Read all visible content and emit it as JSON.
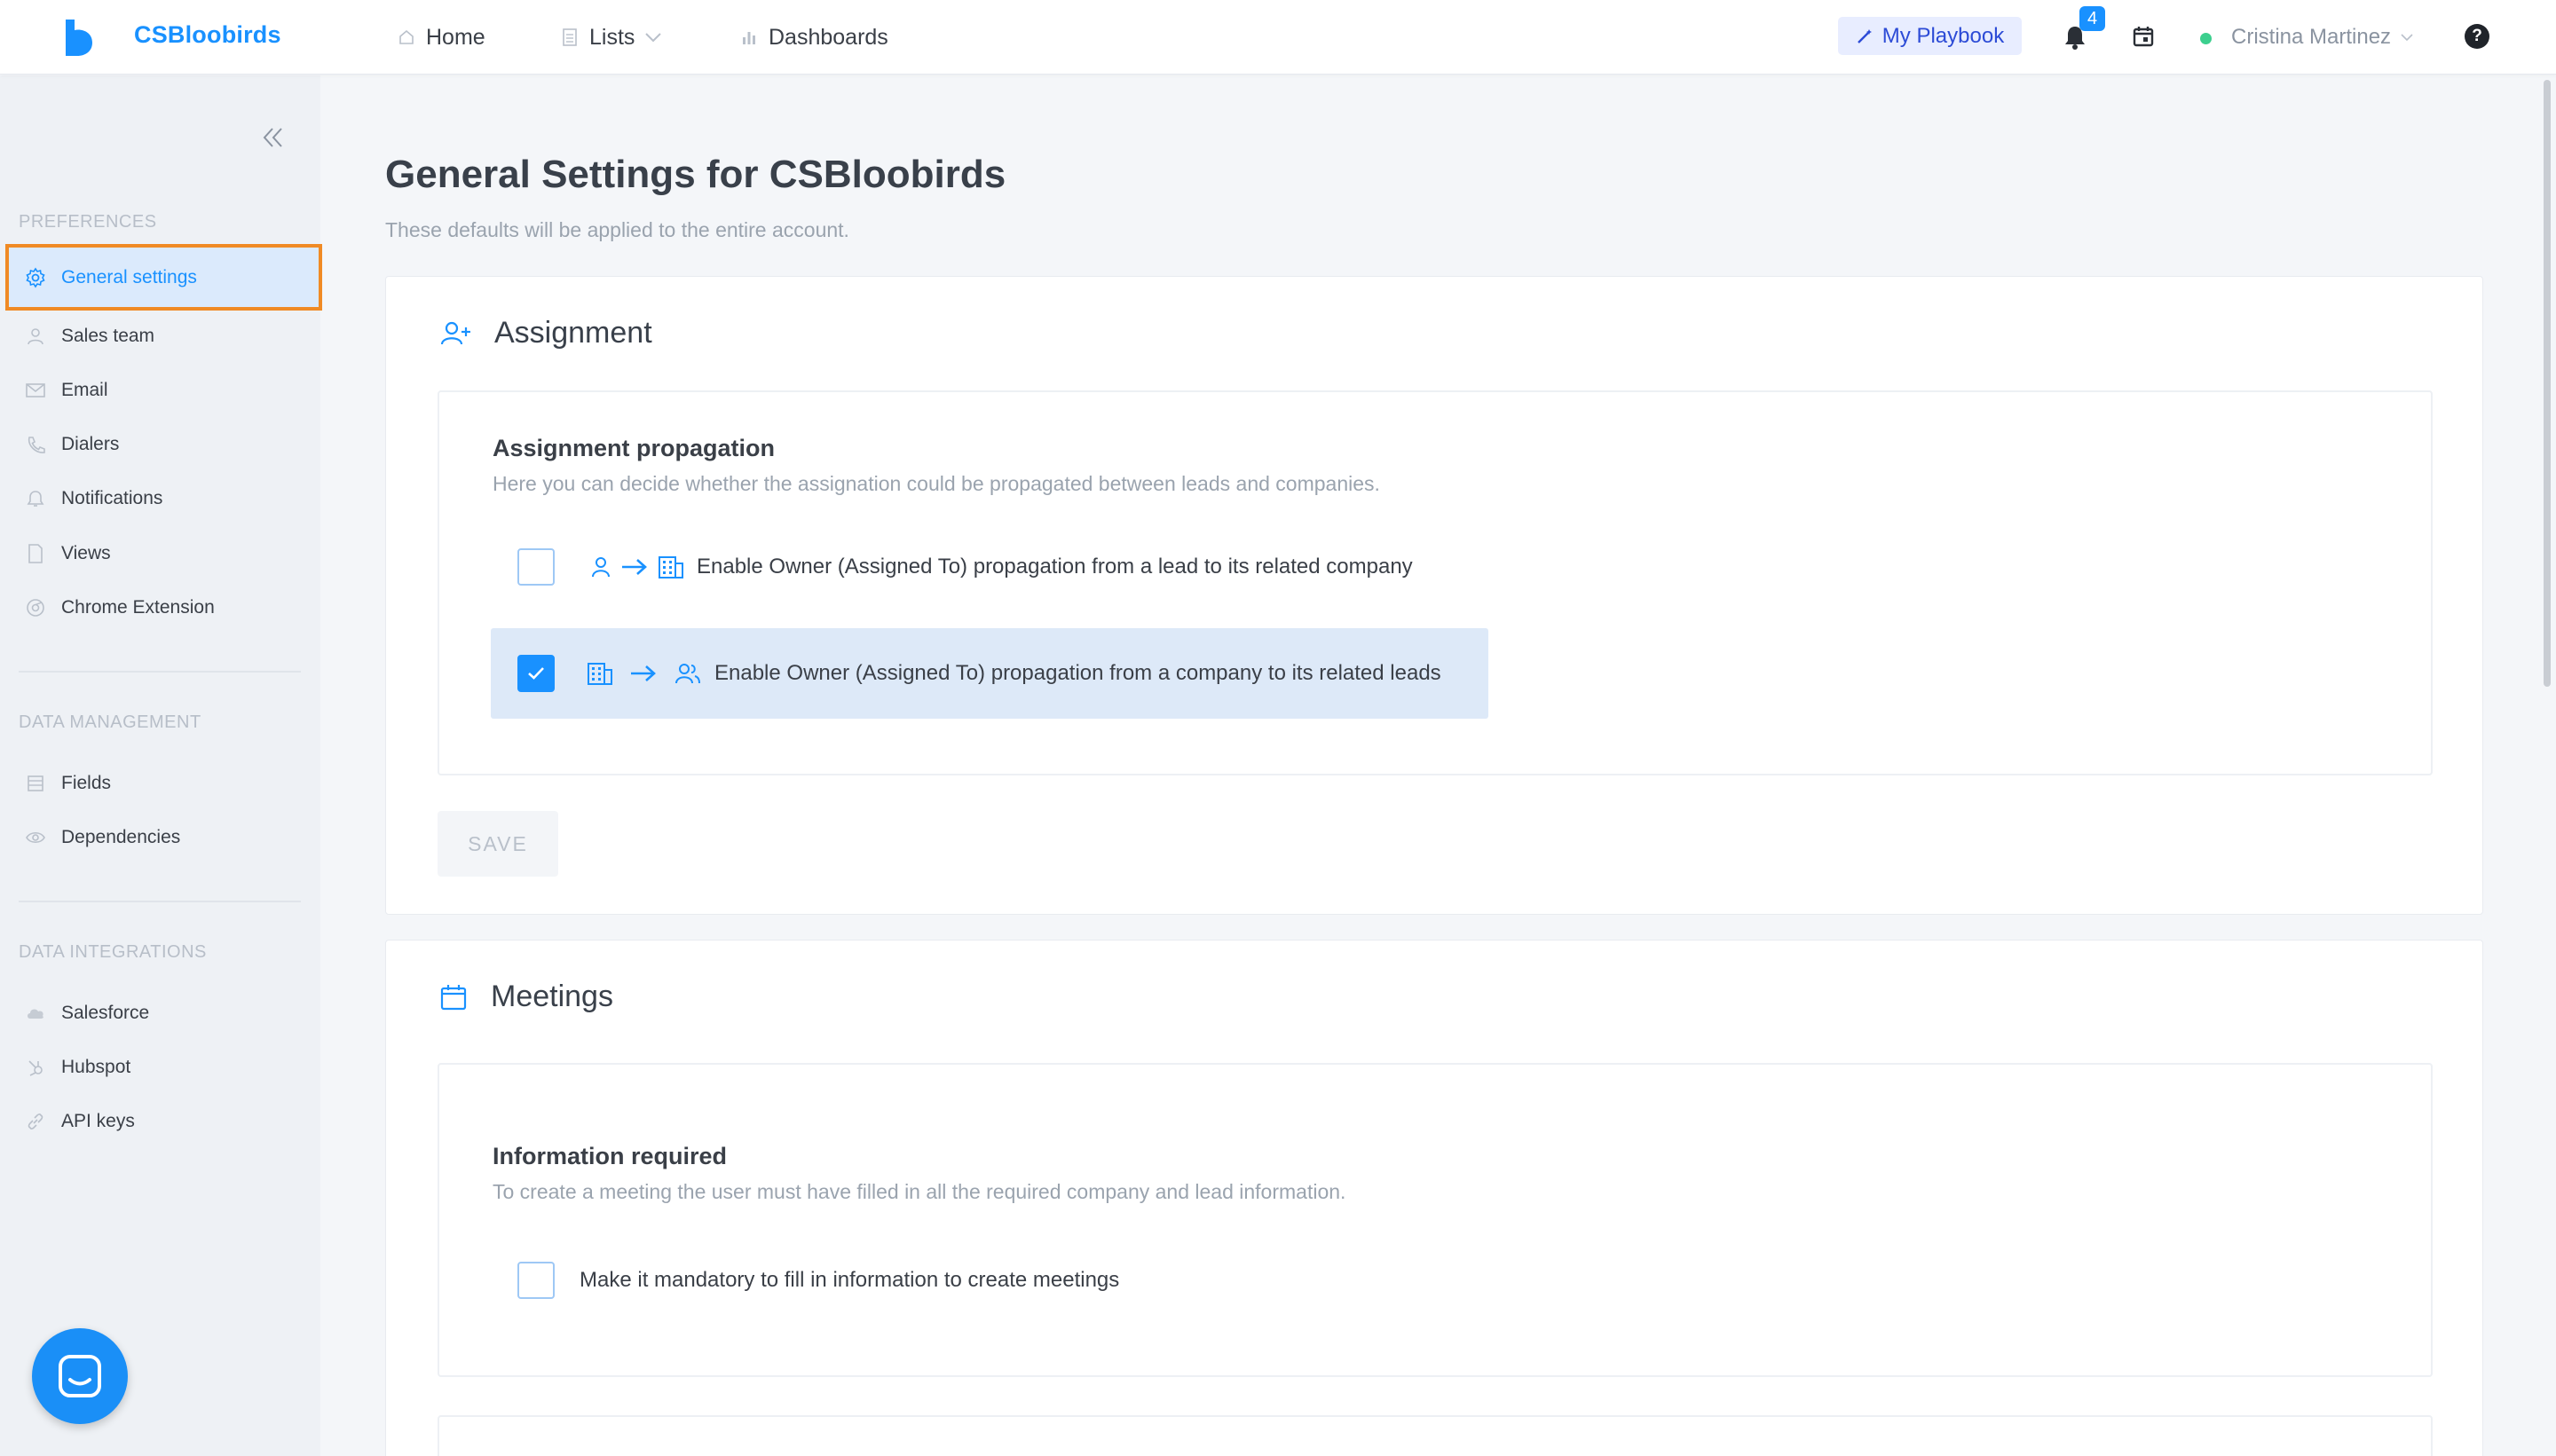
{
  "header": {
    "brand": "CSBloobirds",
    "nav": {
      "home": "Home",
      "lists": "Lists",
      "dashboards": "Dashboards"
    },
    "playbook_label": "My Playbook",
    "notifications_count": "4",
    "user_name": "Cristina Martinez",
    "help_label": "?"
  },
  "sidebar": {
    "preferences_title": "PREFERENCES",
    "preferences": [
      {
        "label": "General settings",
        "icon": "gear-icon"
      },
      {
        "label": "Sales team",
        "icon": "person-icon"
      },
      {
        "label": "Email",
        "icon": "mail-icon"
      },
      {
        "label": "Dialers",
        "icon": "phone-icon"
      },
      {
        "label": "Notifications",
        "icon": "bell-icon"
      },
      {
        "label": "Views",
        "icon": "document-icon"
      },
      {
        "label": "Chrome Extension",
        "icon": "chrome-icon"
      }
    ],
    "data_management_title": "DATA MANAGEMENT",
    "data_management": [
      {
        "label": "Fields",
        "icon": "list-icon"
      },
      {
        "label": "Dependencies",
        "icon": "eye-icon"
      }
    ],
    "data_integrations_title": "DATA INTEGRATIONS",
    "data_integrations": [
      {
        "label": "Salesforce",
        "icon": "cloud-icon"
      },
      {
        "label": "Hubspot",
        "icon": "hubspot-icon"
      },
      {
        "label": "API keys",
        "icon": "link-icon"
      }
    ]
  },
  "main": {
    "title": "General Settings for CSBloobirds",
    "subtitle": "These defaults will be applied to the entire account.",
    "assignment": {
      "heading": "Assignment",
      "section_title": "Assignment propagation",
      "section_desc": "Here you can decide whether the assignation could be propagated between leads and companies.",
      "option1": {
        "label": "Enable Owner (Assigned To) propagation from a lead to its related company",
        "checked": false
      },
      "option2": {
        "label": "Enable Owner (Assigned To) propagation from a company to its related leads",
        "checked": true
      },
      "save_label": "SAVE"
    },
    "meetings": {
      "heading": "Meetings",
      "section_title": "Information required",
      "section_desc": "To create a meeting the user must have filled in all the required company and lead information.",
      "option1": {
        "label": "Make it mandatory to fill in information to create meetings",
        "checked": false
      }
    }
  },
  "colors": {
    "accent": "#1991ff",
    "highlight_outline": "#f08a24",
    "selected_row": "#dde9f8"
  }
}
